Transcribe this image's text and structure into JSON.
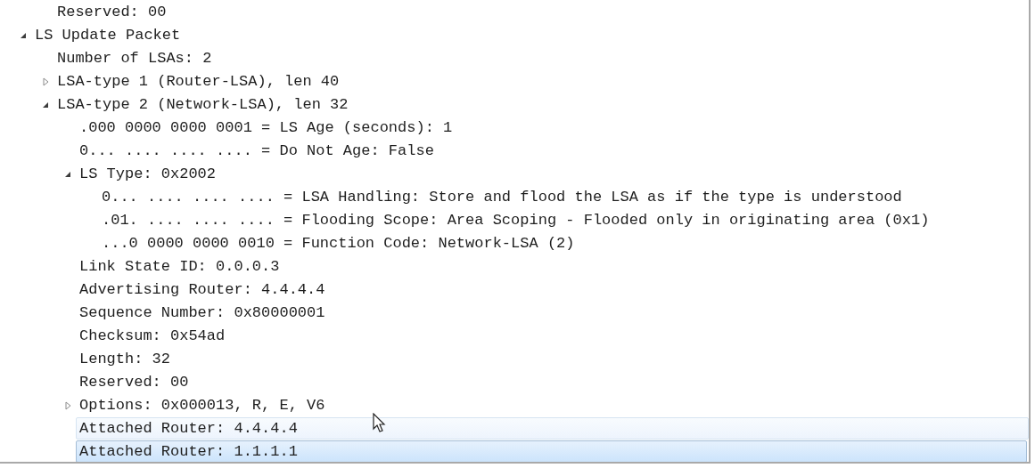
{
  "tree": {
    "previous_children": [
      {
        "label": "Reserved: 00"
      }
    ],
    "items": [
      {
        "label": "LS Update Packet",
        "expanded": true,
        "children": [
          {
            "label": "Number of LSAs: 2"
          },
          {
            "label": "LSA-type 1 (Router-LSA), len 40",
            "expanded": false
          },
          {
            "label": "LSA-type 2 (Network-LSA), len 32",
            "expanded": true,
            "children": [
              {
                "label": ".000 0000 0000 0001 = LS Age (seconds): 1"
              },
              {
                "label": "0... .... .... .... = Do Not Age: False"
              },
              {
                "label": "LS Type: 0x2002",
                "expanded": true,
                "children": [
                  {
                    "label": "0... .... .... .... = LSA Handling: Store and flood the LSA as if the type is understood"
                  },
                  {
                    "label": ".01. .... .... .... = Flooding Scope: Area Scoping - Flooded only in originating area (0x1)"
                  },
                  {
                    "label": "...0 0000 0000 0010 = Function Code: Network-LSA (2)"
                  }
                ]
              },
              {
                "label": "Link State ID: 0.0.0.3"
              },
              {
                "label": "Advertising Router: 4.4.4.4"
              },
              {
                "label": "Sequence Number: 0x80000001"
              },
              {
                "label": "Checksum: 0x54ad"
              },
              {
                "label": "Length: 32"
              },
              {
                "label": "Reserved: 00"
              },
              {
                "label": "Options: 0x000013, R, E, V6",
                "expanded": false
              },
              {
                "label": "Attached Router: 4.4.4.4",
                "hovered": true,
                "selected": false
              },
              {
                "label": "Attached Router: 1.1.1.1",
                "hovered": false,
                "selected": true
              }
            ]
          }
        ]
      }
    ]
  }
}
